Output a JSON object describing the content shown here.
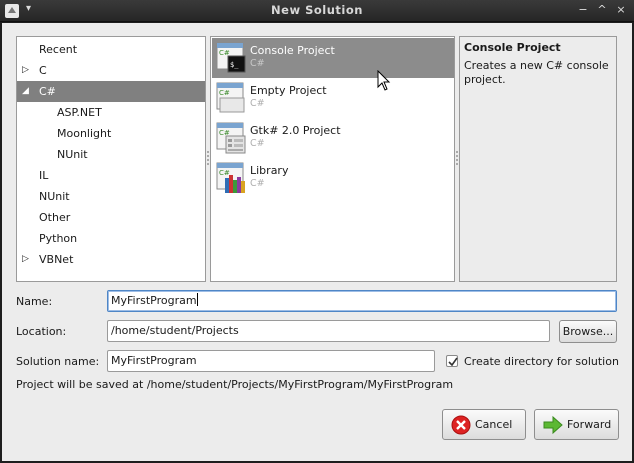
{
  "window": {
    "title": "New Solution",
    "controls": [
      "−",
      "^",
      "×"
    ]
  },
  "categories": [
    {
      "label": "Recent",
      "expander": "",
      "level": 0,
      "selected": false
    },
    {
      "label": "C",
      "expander": "collapsed",
      "level": 0,
      "selected": false
    },
    {
      "label": "C#",
      "expander": "expanded",
      "level": 0,
      "selected": true
    },
    {
      "label": "ASP.NET",
      "expander": "",
      "level": 1,
      "selected": false
    },
    {
      "label": "Moonlight",
      "expander": "",
      "level": 1,
      "selected": false
    },
    {
      "label": "NUnit",
      "expander": "",
      "level": 1,
      "selected": false
    },
    {
      "label": "IL",
      "expander": "",
      "level": 0,
      "selected": false
    },
    {
      "label": "NUnit",
      "expander": "",
      "level": 0,
      "selected": false
    },
    {
      "label": "Other",
      "expander": "",
      "level": 0,
      "selected": false
    },
    {
      "label": "Python",
      "expander": "",
      "level": 0,
      "selected": false
    },
    {
      "label": "VBNet",
      "expander": "collapsed",
      "level": 0,
      "selected": false
    }
  ],
  "projects": [
    {
      "name": "Console Project",
      "language": "C#",
      "icon": "console-project-icon",
      "selected": true
    },
    {
      "name": "Empty Project",
      "language": "C#",
      "icon": "empty-project-icon",
      "selected": false
    },
    {
      "name": "Gtk# 2.0 Project",
      "language": "C#",
      "icon": "gtk-project-icon",
      "selected": false
    },
    {
      "name": "Library",
      "language": "C#",
      "icon": "library-project-icon",
      "selected": false
    }
  ],
  "description": {
    "title": "Console Project",
    "text": "Creates a new C# console project."
  },
  "form": {
    "name_label": "Name:",
    "name_value": "MyFirstProgram",
    "location_label": "Location:",
    "location_value": "/home/student/Projects",
    "browse_label": "Browse...",
    "solution_label": "Solution name:",
    "solution_value": "MyFirstProgram",
    "create_dir_label": "Create directory for solution",
    "create_dir_checked": true,
    "save_path_text": "Project will be saved at /home/student/Projects/MyFirstProgram/MyFirstProgram"
  },
  "buttons": {
    "cancel": "Cancel",
    "forward": "Forward"
  },
  "colors": {
    "selection": "#808080",
    "csharp_icon_text": "#3a8a2a",
    "cancel_icon": "#d22",
    "forward_icon": "#5cb833"
  }
}
